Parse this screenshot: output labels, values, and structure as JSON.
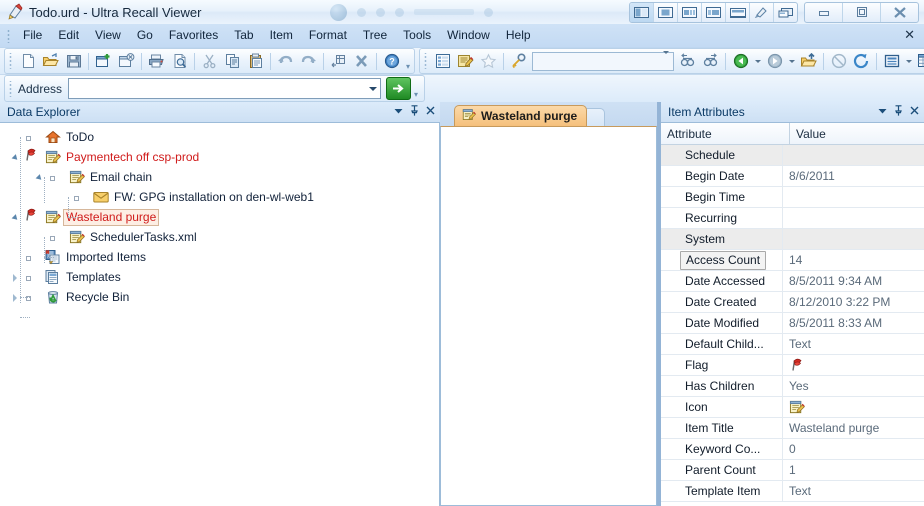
{
  "window": {
    "title": "Todo.urd - Ultra Recall Viewer",
    "app_icon": "ultra-recall-icon",
    "view_buttons": [
      "view-layout-left",
      "view-layout-center",
      "view-layout-split",
      "view-layout-wide",
      "view-layout-horizontal",
      "view-pin",
      "view-restore-pane"
    ],
    "window_buttons": [
      "minimize",
      "maximize",
      "close"
    ]
  },
  "menubar": {
    "items": [
      "File",
      "Edit",
      "View",
      "Go",
      "Favorites",
      "Tab",
      "Item",
      "Format",
      "Tree",
      "Tools",
      "Window",
      "Help"
    ],
    "close_label": "✕"
  },
  "toolbar": {
    "main_icons": [
      "new-document-icon",
      "open-folder-icon",
      "save-icon",
      "new-window-icon",
      "close-window-icon",
      "print-icon",
      "print-preview-icon",
      "cut-icon",
      "copy-icon",
      "paste-icon",
      "undo-icon",
      "redo-icon",
      "move-items-icon",
      "delete-icon",
      "help-icon"
    ],
    "secondary_icons": [
      "outline-view-icon",
      "edit-item-icon",
      "favorite-star-icon",
      "search-key-icon"
    ],
    "search_value": "",
    "nav_icons": [
      "find-prev-icon",
      "find-next-icon",
      "back-icon",
      "forward-icon",
      "up-folder-icon",
      "stop-icon",
      "refresh-icon",
      "properties-icon",
      "grid-view-icon"
    ]
  },
  "address_bar": {
    "label": "Address",
    "value": "",
    "placeholder": "",
    "go_label": "→"
  },
  "data_explorer": {
    "title": "Data Explorer",
    "buttons": [
      "panel-menu",
      "panel-pin",
      "panel-close"
    ],
    "nodes": [
      {
        "label": "ToDo",
        "indent": 0,
        "expander": "none",
        "bullet": true,
        "icon": "home-icon",
        "style": "normal"
      },
      {
        "label": "Paymentech off csp-prod",
        "indent": 0,
        "expander": "open",
        "bullet": false,
        "icon": "note-icon",
        "flag": true,
        "style": "red"
      },
      {
        "label": "Email chain",
        "indent": 1,
        "expander": "open",
        "bullet": true,
        "icon": "note-icon",
        "style": "normal"
      },
      {
        "label": "FW: GPG installation on den-wl-web1",
        "indent": 2,
        "expander": "none",
        "bullet": true,
        "icon": "envelope-icon",
        "style": "normal"
      },
      {
        "label": "Wasteland purge",
        "indent": 0,
        "expander": "open",
        "bullet": false,
        "icon": "note-icon",
        "flag": true,
        "style": "selected"
      },
      {
        "label": "SchedulerTasks.xml",
        "indent": 1,
        "expander": "none",
        "bullet": true,
        "icon": "note-icon",
        "style": "normal"
      },
      {
        "label": "Imported Items",
        "indent": 0,
        "expander": "none",
        "bullet": true,
        "icon": "imported-items-icon",
        "style": "normal"
      },
      {
        "label": "Templates",
        "indent": 0,
        "expander": "closed",
        "bullet": true,
        "icon": "templates-icon",
        "style": "normal"
      },
      {
        "label": "Recycle Bin",
        "indent": 0,
        "expander": "closed",
        "bullet": true,
        "icon": "recycle-bin-icon",
        "style": "normal"
      }
    ]
  },
  "document_area": {
    "tabs": [
      {
        "label": "Wasteland purge",
        "icon": "note-icon",
        "active": true
      }
    ],
    "content": ""
  },
  "item_attributes": {
    "title": "Item Attributes",
    "buttons": [
      "panel-menu",
      "panel-pin",
      "panel-close"
    ],
    "columns": [
      "Attribute",
      "Value"
    ],
    "rows": [
      {
        "attribute": "Schedule",
        "value": "",
        "group": true
      },
      {
        "attribute": "Begin Date",
        "value": "8/6/2011",
        "group": false
      },
      {
        "attribute": "Begin Time",
        "value": "",
        "group": false
      },
      {
        "attribute": "Recurring",
        "value": "",
        "group": false
      },
      {
        "attribute": "System",
        "value": "",
        "group": true
      },
      {
        "attribute": "Access Count",
        "value": "14",
        "group": false,
        "focused": true
      },
      {
        "attribute": "Date Accessed",
        "value": "8/5/2011 9:34 AM",
        "group": false
      },
      {
        "attribute": "Date Created",
        "value": "8/12/2010 3:22 PM",
        "group": false
      },
      {
        "attribute": "Date Modified",
        "value": "8/5/2011 8:33 AM",
        "group": false
      },
      {
        "attribute": "Default Child...",
        "value": "Text",
        "group": false
      },
      {
        "attribute": "Flag",
        "value": "",
        "group": false,
        "value_icon": "red-flag-icon"
      },
      {
        "attribute": "Has Children",
        "value": "Yes",
        "group": false
      },
      {
        "attribute": "Icon",
        "value": "",
        "group": false,
        "value_icon": "note-icon"
      },
      {
        "attribute": "Item Title",
        "value": "Wasteland purge",
        "group": false
      },
      {
        "attribute": "Keyword Co...",
        "value": "0",
        "group": false
      },
      {
        "attribute": "Parent Count",
        "value": "1",
        "group": false
      },
      {
        "attribute": "Template Item",
        "value": "Text",
        "group": false
      }
    ]
  },
  "colors": {
    "accent": "#1b4e7a",
    "tab_active": "#f5c07c",
    "red_item": "#d01b1b",
    "chrome": "#c3daf3",
    "panel_border": "#9dbcd9"
  }
}
